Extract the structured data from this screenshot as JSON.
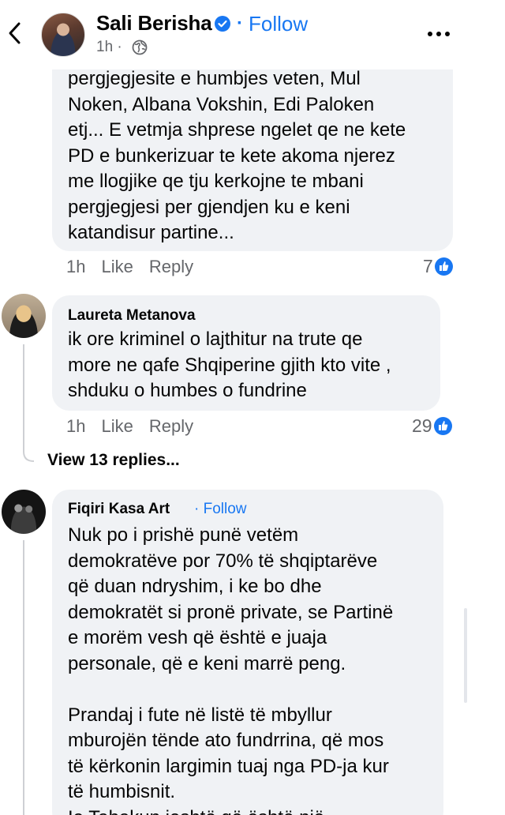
{
  "header": {
    "back_icon": "chevron-left-icon",
    "author": "Sali Berisha",
    "separator": "·",
    "follow": "Follow",
    "time": "1h ·",
    "privacy_icon": "globe-icon",
    "more_icon": "more-horizontal-icon"
  },
  "comments": [
    {
      "author": "",
      "text": "pergjegjesite e humbjes veten, Mul\nNoken, Albana Vokshin, Edi Paloken\netj... E vetmja shprese ngelet qe ne kete\nPD e bunkerizuar te kete akoma njerez\nme llogjike qe tju kerkojne te mbani\npergjegjesi per gjendjen ku e keni\nkatandisur partine...",
      "time": "1h",
      "like": "Like",
      "reply": "Reply",
      "reactions": "7"
    },
    {
      "author": "Laureta Metanova",
      "text": "ik ore kriminel  o lajthitur na trute qe\nmore ne qafe Shqiperine gjith kto vite ,\nshduku o humbes o fundrine",
      "time": "1h",
      "like": "Like",
      "reply": "Reply",
      "reactions": "29",
      "view_replies": "View 13 replies..."
    },
    {
      "author": "Fiqiri Kasa Art",
      "follow": "· Follow",
      "text": "Nuk po i prishë punë vetëm\ndemokratëve por 70%  të shqiptarëve\nqë duan ndryshim, i ke bo dhe\ndemokratët si pronë private, se Partinë\ne morëm vesh që është e juaja\npersonale, që e keni marrë peng.\n\nPrandaj i fute në listë të mbyllur\nmburojën tënde ato fundrrina, që mos\ntë kërkonin largimin tuaj nga PD-ja kur\ntë humbisnit.\nIe Tabakun ieshtë që është një"
    }
  ],
  "colors": {
    "accent": "#1877f2",
    "bubble": "#f0f2f5",
    "secondary_text": "#65676b"
  }
}
